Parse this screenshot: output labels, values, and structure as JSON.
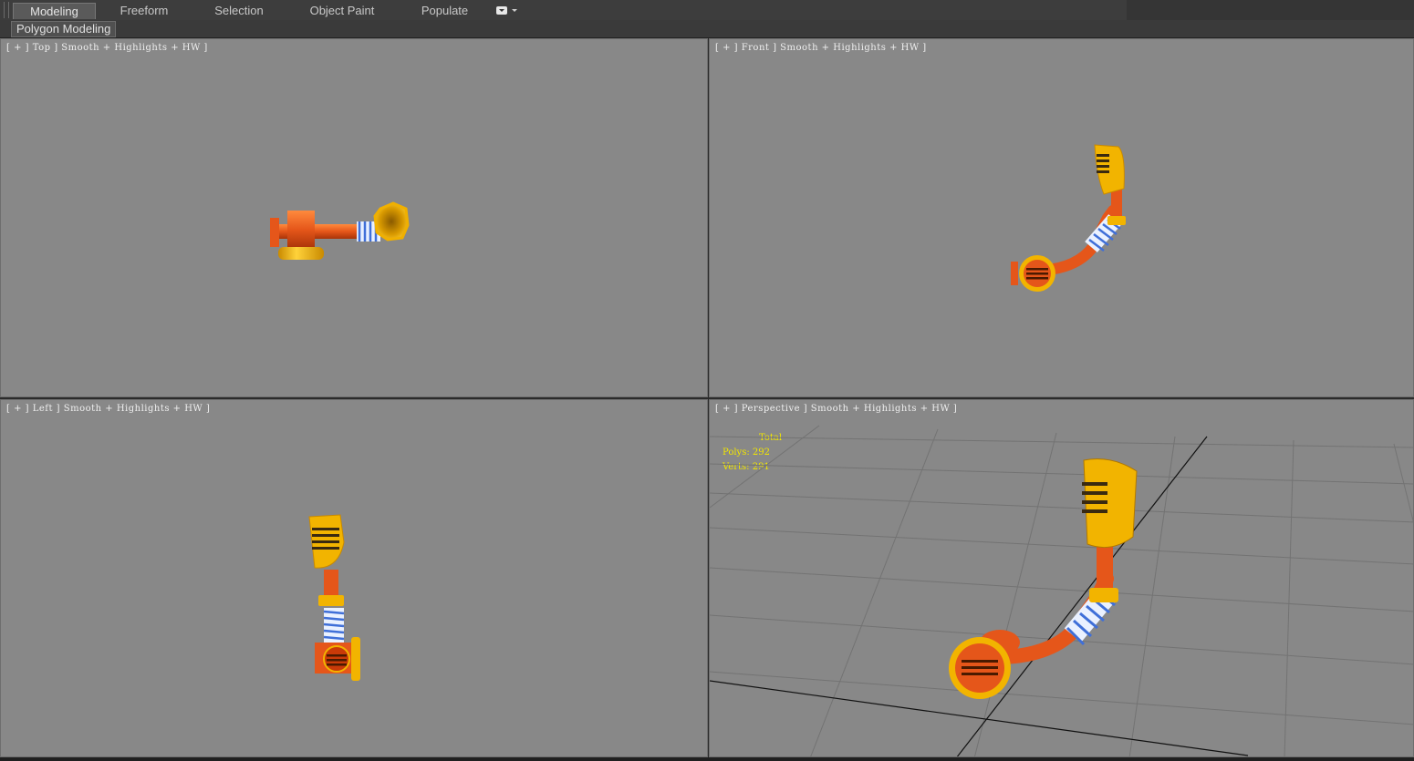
{
  "ribbon": {
    "tabs": [
      {
        "label": "Modeling",
        "active": true
      },
      {
        "label": "Freeform",
        "active": false
      },
      {
        "label": "Selection",
        "active": false
      },
      {
        "label": "Object Paint",
        "active": false
      },
      {
        "label": "Populate",
        "active": false
      }
    ],
    "panel_label": "Polygon Modeling"
  },
  "viewports": {
    "top": {
      "label": "[ + ] Top ] Smooth + Highlights + HW ]",
      "parts": {
        "plus": "[ + ]",
        "view": "Top",
        "shading": "Smooth + Highlights + HW ]"
      }
    },
    "front": {
      "label": "[ + ] Front ] Smooth + Highlights + HW ]",
      "parts": {
        "plus": "[ + ]",
        "view": "Front",
        "shading": "Smooth + Highlights + HW ]"
      }
    },
    "left": {
      "label": "[ + ] Left ] Smooth + Highlights + HW ]",
      "parts": {
        "plus": "[ + ]",
        "view": "Left",
        "shading": "Smooth + Highlights + HW ]"
      }
    },
    "perspective": {
      "label": "[ + ] Perspective ] Smooth + Highlights + HW ]",
      "parts": {
        "plus": "[ + ]",
        "view": "Perspective",
        "shading": "Smooth + Highlights + HW ]"
      }
    }
  },
  "stats": {
    "total": "Total",
    "polys": "Polys: 292",
    "verts": "Verts: 291"
  },
  "colors": {
    "viewport_bg": "#888888",
    "pipe_orange": "#e5561a",
    "metal_yellow": "#f2b400",
    "coil_blue": "#3f6fd8",
    "stats_yellow": "#f2e600"
  }
}
